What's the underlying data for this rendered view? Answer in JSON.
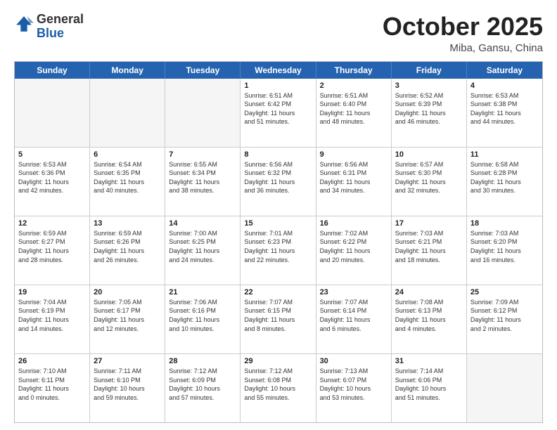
{
  "header": {
    "logo_general": "General",
    "logo_blue": "Blue",
    "month": "October 2025",
    "location": "Miba, Gansu, China"
  },
  "weekdays": [
    "Sunday",
    "Monday",
    "Tuesday",
    "Wednesday",
    "Thursday",
    "Friday",
    "Saturday"
  ],
  "rows": [
    [
      {
        "day": "",
        "text": ""
      },
      {
        "day": "",
        "text": ""
      },
      {
        "day": "",
        "text": ""
      },
      {
        "day": "1",
        "text": "Sunrise: 6:51 AM\nSunset: 6:42 PM\nDaylight: 11 hours\nand 51 minutes."
      },
      {
        "day": "2",
        "text": "Sunrise: 6:51 AM\nSunset: 6:40 PM\nDaylight: 11 hours\nand 48 minutes."
      },
      {
        "day": "3",
        "text": "Sunrise: 6:52 AM\nSunset: 6:39 PM\nDaylight: 11 hours\nand 46 minutes."
      },
      {
        "day": "4",
        "text": "Sunrise: 6:53 AM\nSunset: 6:38 PM\nDaylight: 11 hours\nand 44 minutes."
      }
    ],
    [
      {
        "day": "5",
        "text": "Sunrise: 6:53 AM\nSunset: 6:36 PM\nDaylight: 11 hours\nand 42 minutes."
      },
      {
        "day": "6",
        "text": "Sunrise: 6:54 AM\nSunset: 6:35 PM\nDaylight: 11 hours\nand 40 minutes."
      },
      {
        "day": "7",
        "text": "Sunrise: 6:55 AM\nSunset: 6:34 PM\nDaylight: 11 hours\nand 38 minutes."
      },
      {
        "day": "8",
        "text": "Sunrise: 6:56 AM\nSunset: 6:32 PM\nDaylight: 11 hours\nand 36 minutes."
      },
      {
        "day": "9",
        "text": "Sunrise: 6:56 AM\nSunset: 6:31 PM\nDaylight: 11 hours\nand 34 minutes."
      },
      {
        "day": "10",
        "text": "Sunrise: 6:57 AM\nSunset: 6:30 PM\nDaylight: 11 hours\nand 32 minutes."
      },
      {
        "day": "11",
        "text": "Sunrise: 6:58 AM\nSunset: 6:28 PM\nDaylight: 11 hours\nand 30 minutes."
      }
    ],
    [
      {
        "day": "12",
        "text": "Sunrise: 6:59 AM\nSunset: 6:27 PM\nDaylight: 11 hours\nand 28 minutes."
      },
      {
        "day": "13",
        "text": "Sunrise: 6:59 AM\nSunset: 6:26 PM\nDaylight: 11 hours\nand 26 minutes."
      },
      {
        "day": "14",
        "text": "Sunrise: 7:00 AM\nSunset: 6:25 PM\nDaylight: 11 hours\nand 24 minutes."
      },
      {
        "day": "15",
        "text": "Sunrise: 7:01 AM\nSunset: 6:23 PM\nDaylight: 11 hours\nand 22 minutes."
      },
      {
        "day": "16",
        "text": "Sunrise: 7:02 AM\nSunset: 6:22 PM\nDaylight: 11 hours\nand 20 minutes."
      },
      {
        "day": "17",
        "text": "Sunrise: 7:03 AM\nSunset: 6:21 PM\nDaylight: 11 hours\nand 18 minutes."
      },
      {
        "day": "18",
        "text": "Sunrise: 7:03 AM\nSunset: 6:20 PM\nDaylight: 11 hours\nand 16 minutes."
      }
    ],
    [
      {
        "day": "19",
        "text": "Sunrise: 7:04 AM\nSunset: 6:19 PM\nDaylight: 11 hours\nand 14 minutes."
      },
      {
        "day": "20",
        "text": "Sunrise: 7:05 AM\nSunset: 6:17 PM\nDaylight: 11 hours\nand 12 minutes."
      },
      {
        "day": "21",
        "text": "Sunrise: 7:06 AM\nSunset: 6:16 PM\nDaylight: 11 hours\nand 10 minutes."
      },
      {
        "day": "22",
        "text": "Sunrise: 7:07 AM\nSunset: 6:15 PM\nDaylight: 11 hours\nand 8 minutes."
      },
      {
        "day": "23",
        "text": "Sunrise: 7:07 AM\nSunset: 6:14 PM\nDaylight: 11 hours\nand 6 minutes."
      },
      {
        "day": "24",
        "text": "Sunrise: 7:08 AM\nSunset: 6:13 PM\nDaylight: 11 hours\nand 4 minutes."
      },
      {
        "day": "25",
        "text": "Sunrise: 7:09 AM\nSunset: 6:12 PM\nDaylight: 11 hours\nand 2 minutes."
      }
    ],
    [
      {
        "day": "26",
        "text": "Sunrise: 7:10 AM\nSunset: 6:11 PM\nDaylight: 11 hours\nand 0 minutes."
      },
      {
        "day": "27",
        "text": "Sunrise: 7:11 AM\nSunset: 6:10 PM\nDaylight: 10 hours\nand 59 minutes."
      },
      {
        "day": "28",
        "text": "Sunrise: 7:12 AM\nSunset: 6:09 PM\nDaylight: 10 hours\nand 57 minutes."
      },
      {
        "day": "29",
        "text": "Sunrise: 7:12 AM\nSunset: 6:08 PM\nDaylight: 10 hours\nand 55 minutes."
      },
      {
        "day": "30",
        "text": "Sunrise: 7:13 AM\nSunset: 6:07 PM\nDaylight: 10 hours\nand 53 minutes."
      },
      {
        "day": "31",
        "text": "Sunrise: 7:14 AM\nSunset: 6:06 PM\nDaylight: 10 hours\nand 51 minutes."
      },
      {
        "day": "",
        "text": ""
      }
    ]
  ]
}
